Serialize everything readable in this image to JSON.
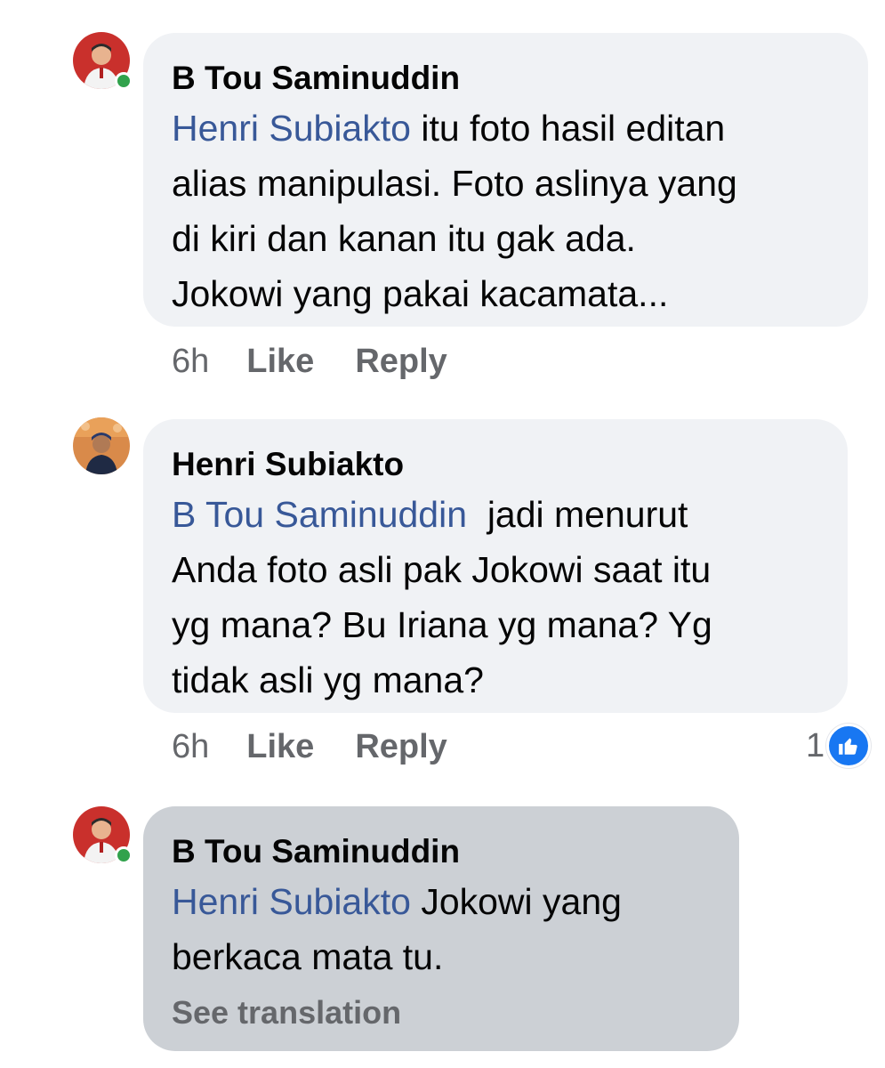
{
  "comments": [
    {
      "author": "B Tou Saminuddin",
      "mention": "Henri Subiakto",
      "text_lines": [
        " itu foto hasil editan",
        "alias manipulasi. Foto aslinya yang",
        "di kiri dan kanan itu gak ada.",
        "Jokowi yang pakai kacamata..."
      ],
      "time": "6h",
      "like_label": "Like",
      "reply_label": "Reply"
    },
    {
      "author": "Henri Subiakto",
      "mention": "B Tou Saminuddin",
      "text_lines": [
        "  jadi menurut",
        "Anda foto asli pak Jokowi saat itu",
        "yg mana? Bu Iriana yg mana? Yg",
        "tidak asli yg mana?"
      ],
      "time": "6h",
      "like_label": "Like",
      "reply_label": "Reply",
      "reaction_count": "1"
    },
    {
      "author": "B Tou Saminuddin",
      "mention": "Henri Subiakto",
      "text_lines": [
        " Jokowi yang",
        "berkaca mata tu."
      ],
      "see_translation": "See translation"
    }
  ],
  "colors": {
    "bubble": "#f0f2f5",
    "bubble_highlight": "#ccd0d5",
    "mention": "#385898",
    "meta": "#65676b",
    "like_blue": "#1877f2",
    "online": "#31a24c"
  },
  "icons": {
    "reaction": "thumbs-up-icon",
    "presence": "online-dot"
  }
}
